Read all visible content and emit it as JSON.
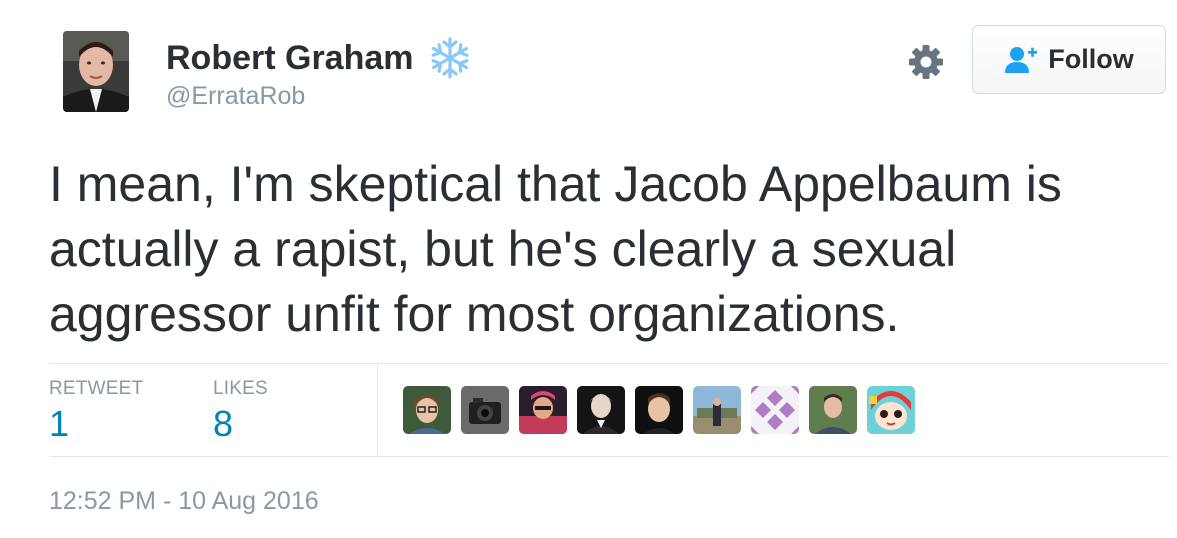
{
  "author": {
    "name": "Robert Graham",
    "handle": "@ErrataRob",
    "badge_icon": "snowflake-icon"
  },
  "header": {
    "settings_icon": "gear-icon",
    "follow_label": "Follow",
    "follow_icon": "add-user-icon"
  },
  "tweet": {
    "text": "I mean, I'm skeptical that Jacob Appelbaum is\nactually a rapist, but he's clearly a sexual\naggressor unfit for most organizations."
  },
  "stats": {
    "retweets_label": "RETWEET",
    "retweets_count": "1",
    "likes_label": "LIKES",
    "likes_count": "8"
  },
  "timestamp": "12:52 PM - 10 Aug 2016",
  "colors": {
    "text": "#292f33",
    "muted": "#8899a6",
    "link": "#0084b4",
    "follow_icon": "#1da1f2",
    "snowflake": "#88c9f9"
  }
}
